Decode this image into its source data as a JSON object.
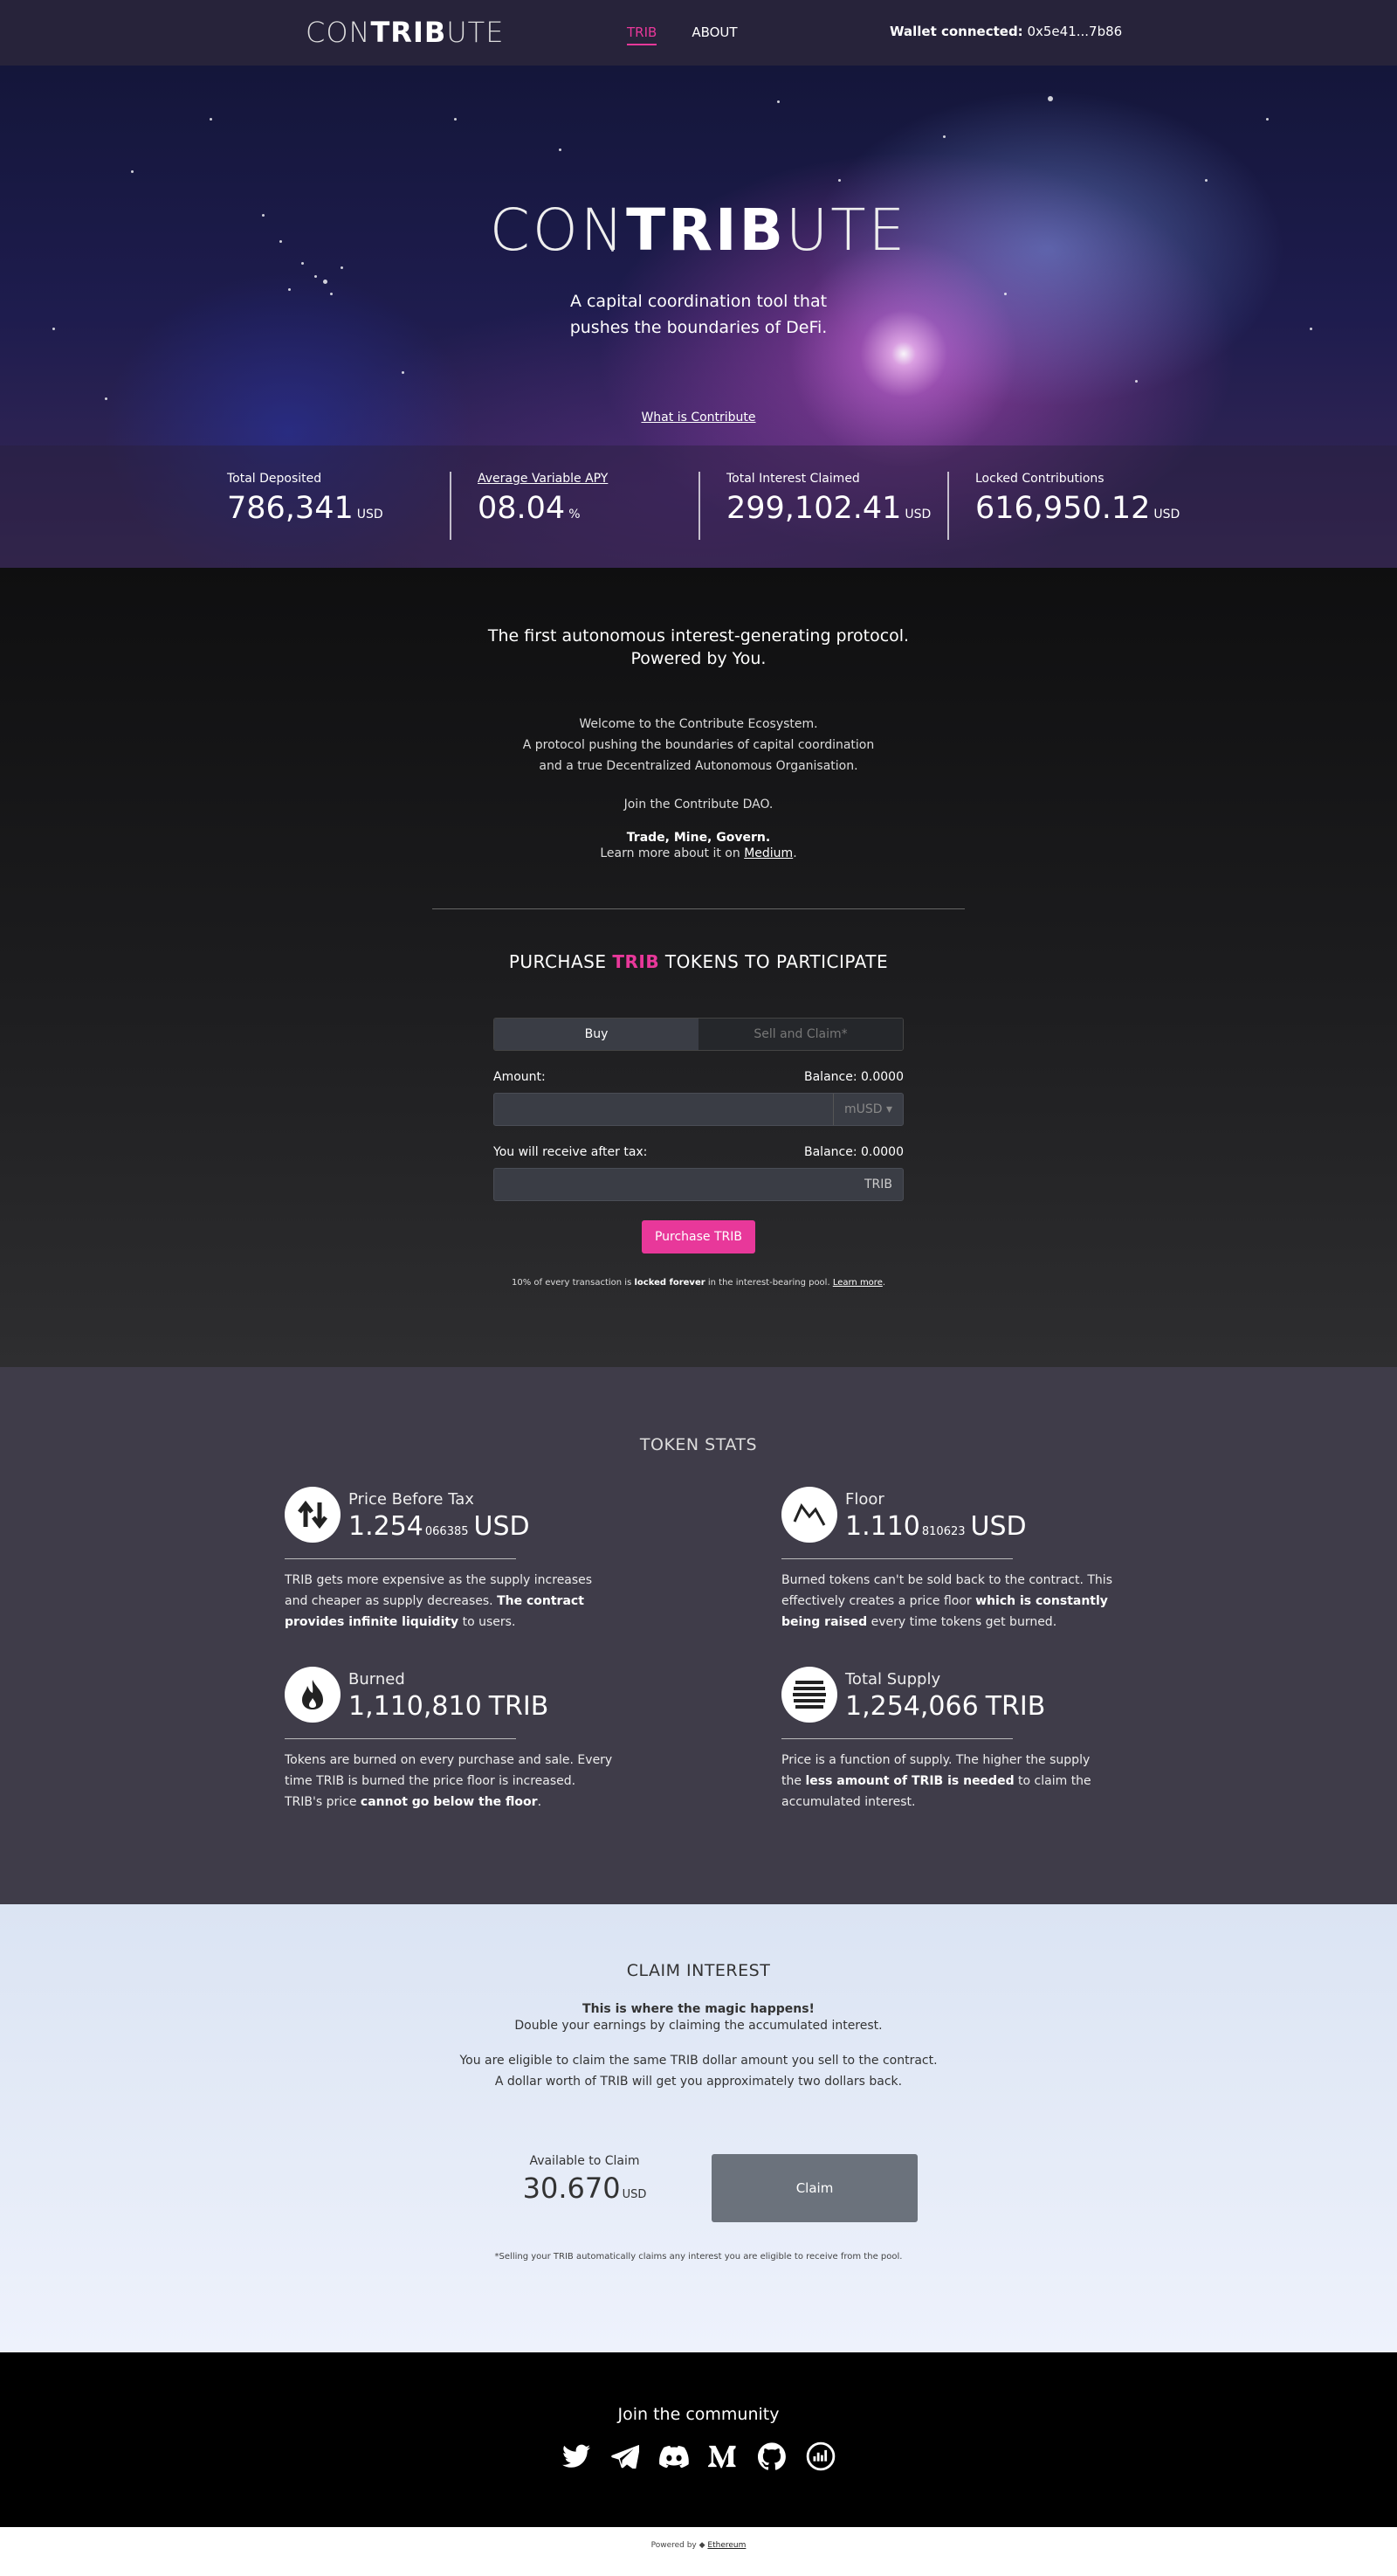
{
  "nav": {
    "logo_light": "CON",
    "logo_bold": "TRIB",
    "logo_tail": "UTE",
    "links": [
      "TRIB",
      "ABOUT"
    ],
    "wallet_label": "Wallet connected:",
    "wallet_address": "0x5e41...7b86"
  },
  "hero": {
    "logo_light": "CON",
    "logo_bold": "TRIB",
    "logo_tail": "UTE",
    "tagline_1": "A capital coordination tool that",
    "tagline_2": "pushes the boundaries of DeFi.",
    "what_link": "What is Contribute",
    "stats": [
      {
        "label": "Total Deposited",
        "value": "786,341",
        "unit": "USD"
      },
      {
        "label": "Average Variable APY",
        "value": "08.04",
        "unit": "%"
      },
      {
        "label": "Total Interest Claimed",
        "value": "299,102.41",
        "unit": "USD"
      },
      {
        "label": "Locked Contributions",
        "value": "616,950.12",
        "unit": "USD"
      }
    ]
  },
  "intro": {
    "heading_1": "The first autonomous interest-generating protocol.",
    "heading_2": "Powered by You.",
    "welcome_1": "Welcome to the Contribute Ecosystem.",
    "welcome_2": "A protocol pushing the boundaries of capital coordination",
    "welcome_3": "and a true Decentralized Autonomous Organisation.",
    "join": "Join the Contribute DAO.",
    "tmg": "Trade, Mine, Govern.",
    "learn_prefix": "Learn more about it on ",
    "learn_link": "Medium",
    "learn_suffix": "."
  },
  "purchase": {
    "title_prefix": "PURCHASE ",
    "title_accent": "TRIB",
    "title_suffix": " TOKENS TO PARTICIPATE",
    "tab_buy": "Buy",
    "tab_sell": "Sell and Claim*",
    "amount_label": "Amount:",
    "amount_balance": "Balance: 0.0000",
    "amount_currency": "mUSD",
    "receive_label": "You will receive after tax:",
    "receive_balance": "Balance: 0.0000",
    "receive_currency": "TRIB",
    "button": "Purchase TRIB",
    "fine_1": "10% of every transaction is ",
    "fine_bold": "locked forever",
    "fine_2": " in the interest-bearing pool. ",
    "fine_link": "Learn more",
    "fine_end": "."
  },
  "token_stats": {
    "title": "TOKEN STATS",
    "cards": [
      {
        "name": "Price Before Tax",
        "value": "1.254",
        "small": "066385",
        "unit": "USD",
        "desc_1": "TRIB gets more expensive as the supply increases and cheaper as supply decreases. ",
        "desc_bold": "The contract provides infinite liquidity",
        "desc_2": " to users.",
        "icon": "arrows-up-down-icon"
      },
      {
        "name": "Floor",
        "value": "1.110",
        "small": "810623",
        "unit": "USD",
        "desc_1": "Burned tokens can't be sold back to the contract. This effectively creates a price floor ",
        "desc_bold": "which is constantly being raised",
        "desc_2": " every time tokens get burned.",
        "icon": "chart-icon"
      },
      {
        "name": "Burned",
        "value": "1,110,810",
        "small": "",
        "unit": "TRIB",
        "desc_1": "Tokens are burned on every purchase and sale. Every time TRIB is burned the price floor is increased. TRIB's price ",
        "desc_bold": "cannot go below the floor",
        "desc_2": ".",
        "icon": "flame-icon"
      },
      {
        "name": "Total Supply",
        "value": "1,254,066",
        "small": "",
        "unit": "TRIB",
        "desc_1": "Price is a function of supply. The higher the supply the ",
        "desc_bold": "less amount of TRIB is needed",
        "desc_2": " to claim the accumulated interest.",
        "icon": "stack-icon"
      }
    ]
  },
  "claim": {
    "title": "CLAIM INTEREST",
    "magic": "This is where the magic happens!",
    "double": "Double your earnings by claiming the accumulated interest.",
    "elig_1": "You are eligible to claim the same TRIB dollar amount you sell to the contract.",
    "elig_2": "A dollar worth of TRIB will get you approximately two dollars back.",
    "avail_label": "Available to Claim",
    "avail_value": "30.670",
    "avail_unit": "USD",
    "button": "Claim",
    "note": "*Selling your TRIB automatically claims any interest you are eligible to receive from the pool."
  },
  "footer": {
    "join": "Join the community",
    "icons": [
      "twitter-icon",
      "telegram-icon",
      "discord-icon",
      "medium-icon",
      "github-icon",
      "analytics-icon"
    ],
    "powered_prefix": "Powered by ",
    "powered_link": "Ethereum"
  }
}
